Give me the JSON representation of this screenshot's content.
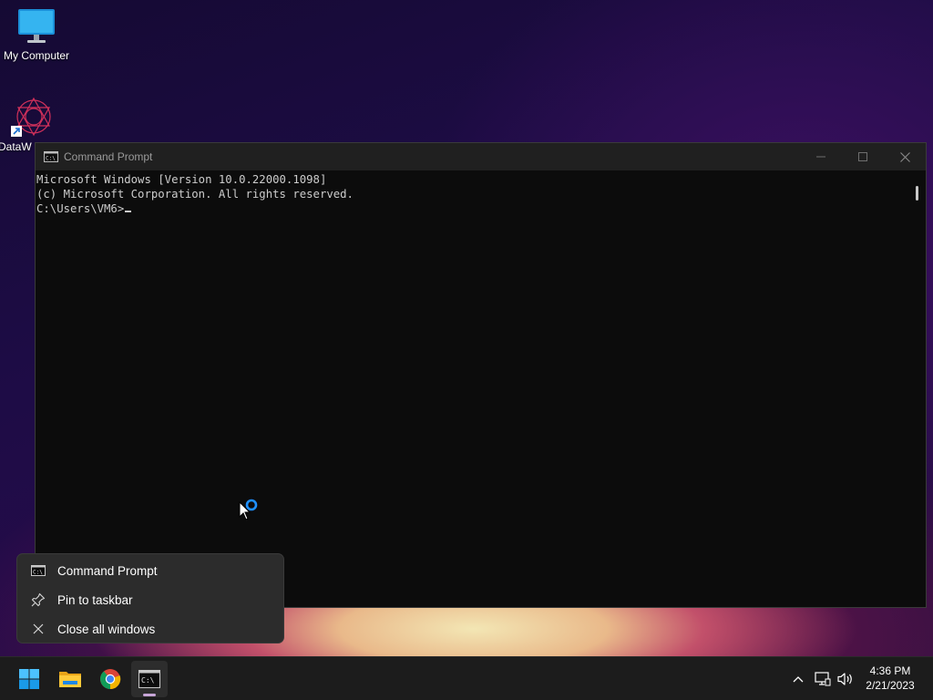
{
  "desktop": {
    "icons": [
      {
        "label": "My Computer"
      },
      {
        "label": "DataW"
      }
    ]
  },
  "cmd_window": {
    "title": "Command Prompt",
    "lines": [
      "Microsoft Windows [Version 10.0.22000.1098]",
      "(c) Microsoft Corporation. All rights reserved.",
      "C:\\Users\\VM6>"
    ],
    "controls": [
      "minimize",
      "maximize",
      "close"
    ]
  },
  "jumplist": {
    "items": [
      {
        "label": "Command Prompt",
        "icon": "cmd-icon"
      },
      {
        "label": "Pin to taskbar",
        "icon": "pin-icon"
      },
      {
        "label": "Close all windows",
        "icon": "close-icon"
      }
    ]
  },
  "taskbar": {
    "apps": [
      "start",
      "file-explorer",
      "chrome",
      "command-prompt"
    ],
    "tray": {
      "time": "4:36 PM",
      "date": "2/21/2023"
    }
  },
  "colors": {
    "accent": "#0078d4",
    "taskbar_bg": "#1c1c1c",
    "console_bg": "#0c0c0c",
    "console_text": "#cccccc"
  }
}
